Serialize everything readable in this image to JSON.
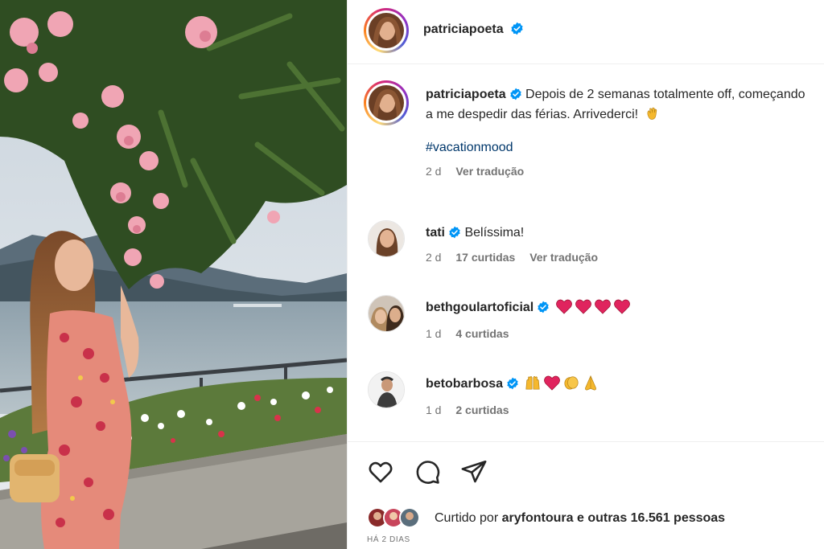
{
  "post": {
    "author": "patriciapoeta",
    "caption": "Depois de 2 semanas totalmente off, começando a me despedir das férias. Arrivederci!",
    "caption_emoji": "wave-hand",
    "hashtag": "#vacationmood",
    "caption_age": "2 d",
    "translate_label": "Ver tradução"
  },
  "comments": [
    {
      "user": "tati",
      "text": "Belíssima!",
      "age": "2 d",
      "likes": "17 curtidas",
      "translate": "Ver tradução"
    },
    {
      "user": "bethgoulartoficial",
      "text": "",
      "emojis": [
        "red-heart",
        "red-heart",
        "red-heart",
        "red-heart"
      ],
      "age": "1 d",
      "likes": "4 curtidas"
    },
    {
      "user": "betobarbosa",
      "text": "",
      "emojis": [
        "raising-hands",
        "red-heart",
        "clapping-hands",
        "folded-hands"
      ],
      "age": "1 d",
      "likes": "2 curtidas"
    }
  ],
  "likes": {
    "prefix": "Curtido por",
    "user": "aryfontoura",
    "suffix": "e outras 16.561 pessoas"
  },
  "timestamp": "HÁ 2 DIAS",
  "colors": {
    "verified": "#0095f6",
    "hashtag": "#00376b",
    "heart": "#e0245e",
    "meta": "#737373"
  }
}
